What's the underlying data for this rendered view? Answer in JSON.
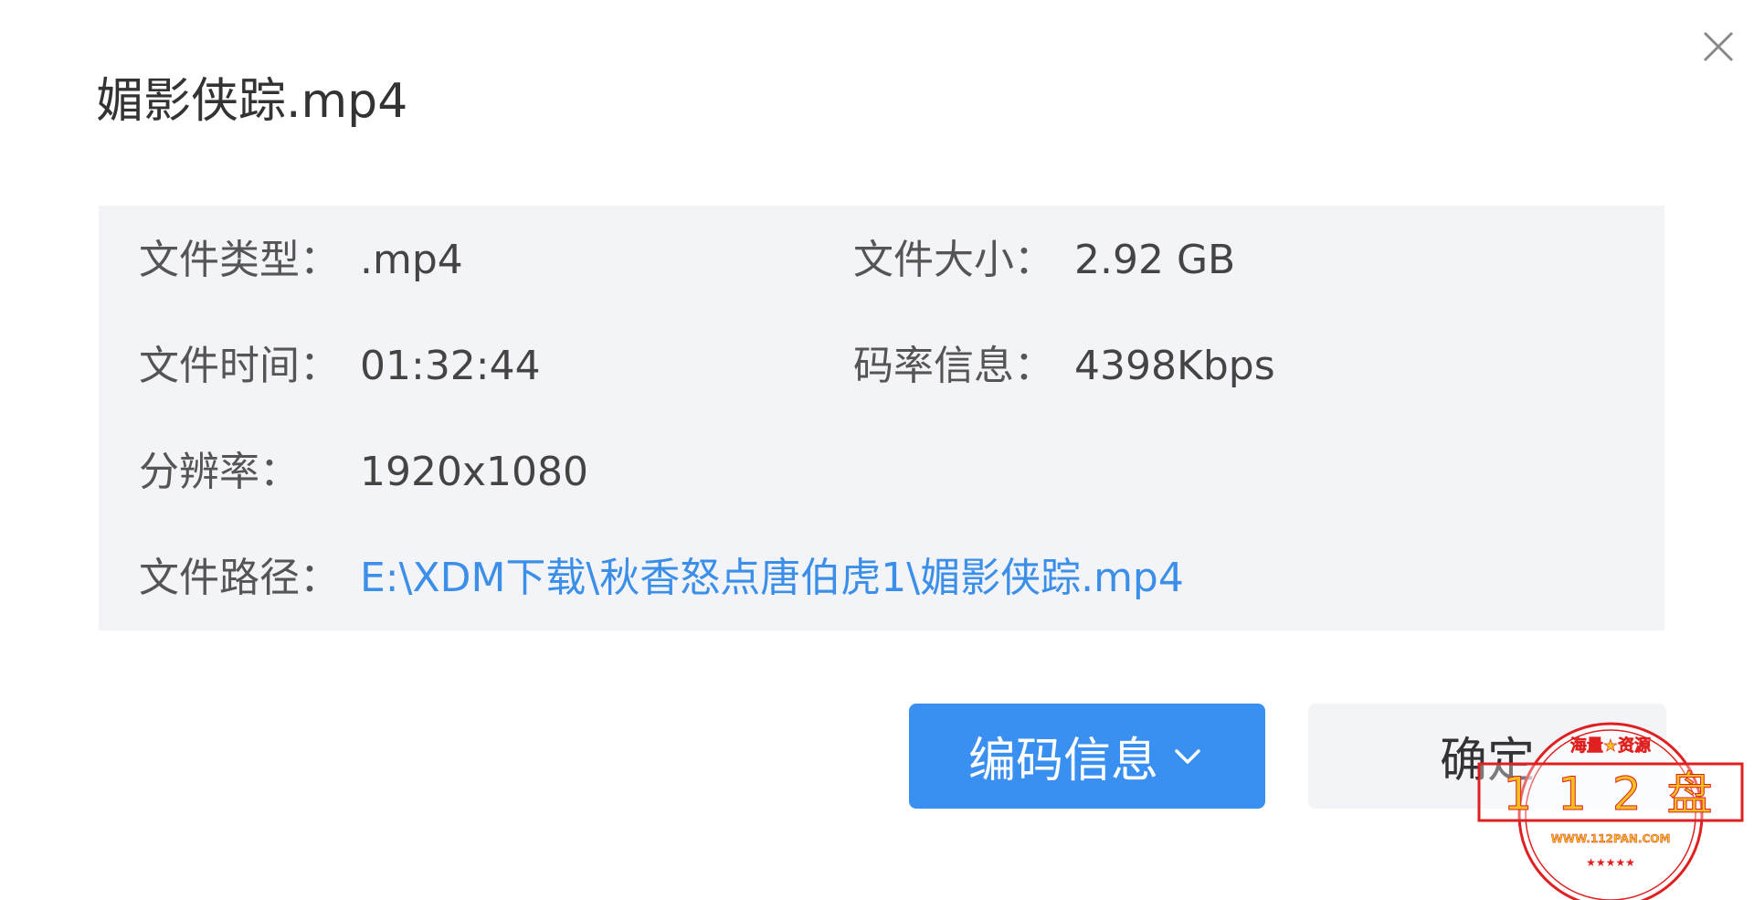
{
  "dialog": {
    "title": "媚影侠踪.mp4",
    "close_icon": "close-icon"
  },
  "info": {
    "file_type_label": "文件类型：",
    "file_type_value": ".mp4",
    "file_size_label": "文件大小：",
    "file_size_value": "2.92 GB",
    "file_time_label": "文件时间：",
    "file_time_value": "01:32:44",
    "bitrate_label": "码率信息：",
    "bitrate_value": "4398Kbps",
    "resolution_label": "分辨率：",
    "resolution_value": "1920x1080",
    "path_label": "文件路径：",
    "path_value": "E:\\XDM下载\\秋香怒点唐伯虎1\\媚影侠踪.mp4"
  },
  "buttons": {
    "codec_info_label": "编码信息",
    "codec_info_icon": "chevron-down-icon",
    "confirm_label": "确定"
  },
  "watermark": {
    "top_text": "海量★资源",
    "main_text": "1 1 2 盘",
    "url_text": "WWW.112PAN.COM",
    "bottom_text": "★★★★★",
    "color": "#e02020",
    "accent_color": "#f0c020"
  },
  "colors": {
    "accent": "#3a90f0",
    "link": "#3b8fe8",
    "panel_bg": "#f2f4f8"
  }
}
